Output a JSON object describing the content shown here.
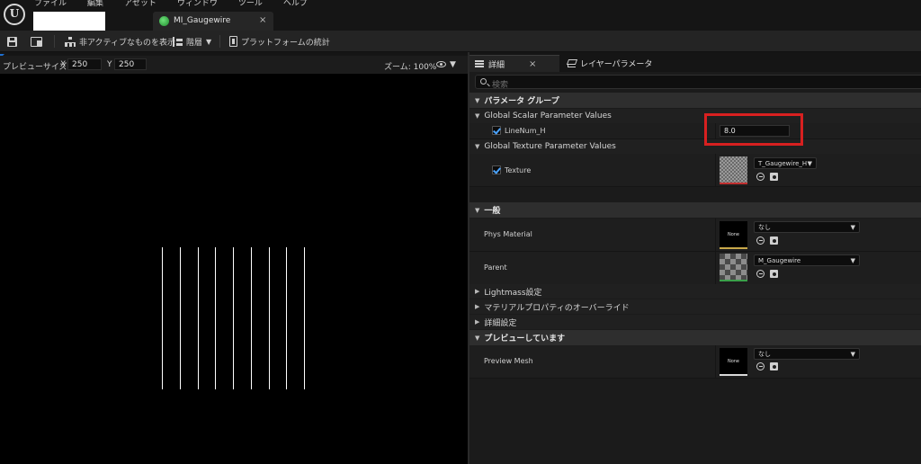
{
  "menu": [
    "ファイル",
    "編集",
    "アセット",
    "ウィンドウ",
    "ツール",
    "ヘルプ"
  ],
  "document_tab": {
    "title": "MI_Gaugewire",
    "close": "×"
  },
  "toolbar": {
    "show_inactive": "非アクティブなものを表示",
    "hierarchy": "階層",
    "platform_stats": "プラットフォームの統計"
  },
  "viewport": {
    "preview_size_label": "プレビューサイズ",
    "x_label": "X",
    "x_value": "250",
    "y_label": "Y",
    "y_value": "250",
    "zoom": "ズーム: 100%",
    "line_count": 9
  },
  "details_panel": {
    "tab_details": "詳細",
    "tab_close": "×",
    "tab_layer_params": "レイヤーパラメータ",
    "search_placeholder": "検索",
    "param_group_header": "パラメータ グループ",
    "scalar_group": "Global Scalar Parameter Values",
    "scalar_param": {
      "name": "LineNum_H",
      "value": "8.0",
      "enabled": true
    },
    "texture_group": "Global Texture Parameter Values",
    "texture_param": {
      "name": "Texture",
      "asset": "T_Gaugewire_H",
      "enabled": true
    },
    "general_header": "一般",
    "phys_material": {
      "label": "Phys Material",
      "thumb": "None",
      "asset": "なし"
    },
    "parent": {
      "label": "Parent",
      "asset": "M_Gaugewire"
    },
    "collapsed_sections": [
      "Lightmass設定",
      "マテリアルプロパティのオーバーライド",
      "詳細設定"
    ],
    "previewing_header": "プレビューしています",
    "preview_mesh": {
      "label": "Preview Mesh",
      "thumb": "None",
      "asset": "なし"
    }
  },
  "colors": {
    "highlight_frame": "#d82020",
    "checkbox_check": "#4aa3ff",
    "viewport_bg": "#000000",
    "panel_bg": "#1b1b1b"
  }
}
